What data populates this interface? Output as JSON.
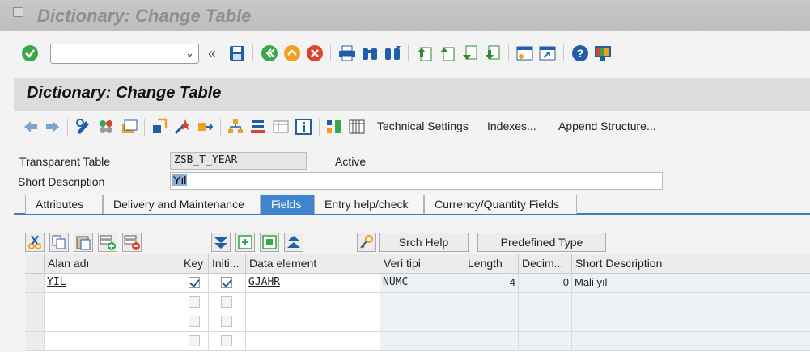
{
  "window": {
    "title": "Dictionary: Change Table"
  },
  "system_toolbar": {
    "command_field_value": "",
    "icons": [
      "enter-icon",
      "back-icon",
      "save-icon",
      "exit-icon",
      "cancel-icon",
      "print-icon",
      "find-icon",
      "find-next-icon",
      "first-page-icon",
      "previous-page-icon",
      "next-page-icon",
      "last-page-icon",
      "new-session-icon",
      "shortcut-icon",
      "help-icon",
      "customize-layout-icon"
    ]
  },
  "header": {
    "title": "Dictionary: Change Table"
  },
  "app_toolbar": {
    "technical_settings": "Technical Settings",
    "indexes": "Indexes...",
    "append_structure": "Append Structure..."
  },
  "form": {
    "table_label": "Transparent Table",
    "table_value": "ZSB_T_YEAR",
    "status": "Active",
    "short_desc_label": "Short Description",
    "short_desc_value": "Yıl"
  },
  "tabs": [
    {
      "label": "Attributes",
      "active": false
    },
    {
      "label": "Delivery and Maintenance",
      "active": false
    },
    {
      "label": "Fields",
      "active": true
    },
    {
      "label": "Entry help/check",
      "active": false
    },
    {
      "label": "Currency/Quantity Fields",
      "active": false
    }
  ],
  "fields_toolbar": {
    "search_help": "Srch Help",
    "predefined_type": "Predefined Type"
  },
  "grid": {
    "columns": [
      "Alan adı",
      "Key",
      "Initi...",
      "Data element",
      "Veri tipi",
      "Length",
      "Decim...",
      "Short Description"
    ],
    "rows": [
      {
        "field": "YIL",
        "key": true,
        "initial": true,
        "data_element": "GJAHR",
        "data_type": "NUMC",
        "length": "4",
        "decimals": "0",
        "short_desc": "Mali yıl"
      },
      {
        "field": "",
        "key": false,
        "initial": false,
        "data_element": "",
        "data_type": "",
        "length": "",
        "decimals": "",
        "short_desc": ""
      },
      {
        "field": "",
        "key": false,
        "initial": false,
        "data_element": "",
        "data_type": "",
        "length": "",
        "decimals": "",
        "short_desc": ""
      },
      {
        "field": "",
        "key": false,
        "initial": false,
        "data_element": "",
        "data_type": "",
        "length": "",
        "decimals": "",
        "short_desc": ""
      }
    ]
  },
  "colors": {
    "active_tab": "#3f84cc",
    "enter_green": "#3aa84a",
    "exit_orange": "#f0a020",
    "cancel_red": "#d9452b"
  }
}
